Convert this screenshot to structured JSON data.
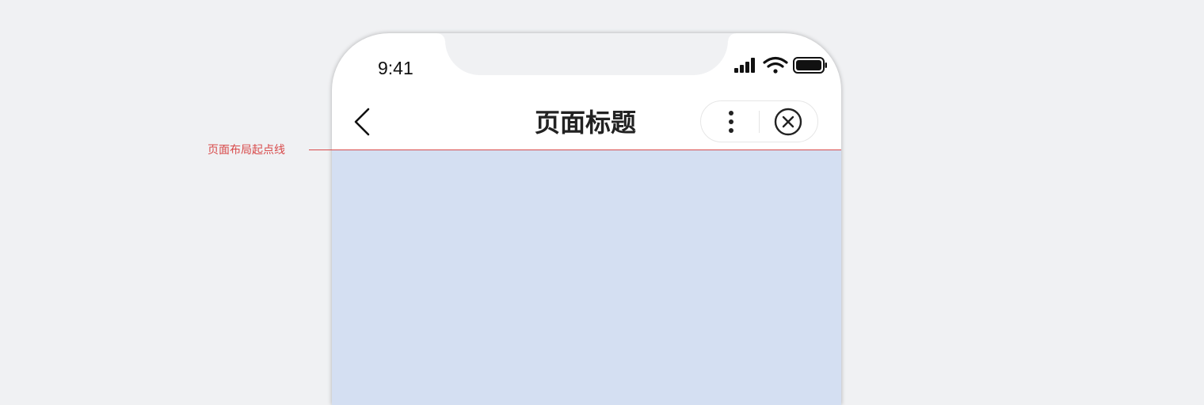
{
  "annotation": {
    "label": "页面布局起点线",
    "color": "#d84a4a"
  },
  "status_bar": {
    "time": "9:41",
    "icons": [
      "signal-icon",
      "wifi-icon",
      "battery-icon"
    ]
  },
  "nav_bar": {
    "title": "页面标题",
    "back_icon": "chevron-left-icon",
    "more_icon": "more-vertical-icon",
    "close_icon": "close-circle-icon"
  },
  "colors": {
    "background": "#f0f1f3",
    "content_area": "#d4dff2",
    "title_text": "#222222"
  }
}
